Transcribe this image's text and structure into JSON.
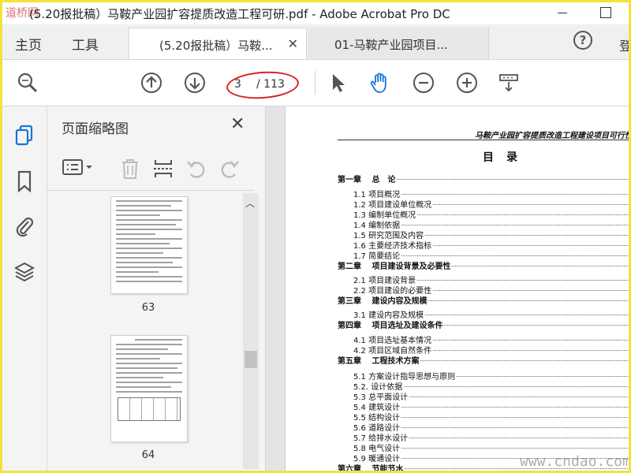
{
  "window": {
    "title": "(5.20报批稿）马鞍产业园扩容提质改造工程可研.pdf - Adobe Acrobat Pro DC",
    "logo_text": "道桥网"
  },
  "tabs": {
    "home": "主页",
    "tools": "工具",
    "doc_active": "(5.20报批稿）马鞍...",
    "doc_inactive": "01-马鞍产业园项目...",
    "login": "登"
  },
  "toolbar": {
    "page_current": "3",
    "page_total": "/ 113",
    "icons": [
      "zoom-icon",
      "page-up-icon",
      "page-down-icon",
      "select-arrow-icon",
      "hand-icon",
      "zoom-out-icon",
      "zoom-in-icon",
      "scroll-mode-icon"
    ]
  },
  "panel": {
    "title": "页面缩略图",
    "thumbs": [
      {
        "label": "63"
      },
      {
        "label": "64"
      }
    ]
  },
  "doc": {
    "header": "马鞍产业园扩容提质改造工程建设项目可行性",
    "title": "目录",
    "toc": [
      {
        "text": "第一章　 总　论",
        "chapter": true
      },
      {
        "text": "1.1 项目概况",
        "chapter": false
      },
      {
        "text": "1.2 项目建设单位概况",
        "chapter": false
      },
      {
        "text": "1.3 编制单位概况",
        "chapter": false
      },
      {
        "text": "1.4 编制依据",
        "chapter": false
      },
      {
        "text": "1.5 研究范围及内容",
        "chapter": false
      },
      {
        "text": "1.6 主要经济技术指标",
        "chapter": false
      },
      {
        "text": "1.7 简要结论",
        "chapter": false
      },
      {
        "text": "第二章　 项目建设背景及必要性",
        "chapter": true
      },
      {
        "text": "2.1 项目建设背景",
        "chapter": false
      },
      {
        "text": "2.2 项目建设的必要性",
        "chapter": false
      },
      {
        "text": "第三章　 建设内容及规模",
        "chapter": true
      },
      {
        "text": "3.1 建设内容及规模",
        "chapter": false
      },
      {
        "text": "第四章　 项目选址及建设条件",
        "chapter": true
      },
      {
        "text": "4.1 项目选址基本情况",
        "chapter": false
      },
      {
        "text": "4.2 项目区域自然条件",
        "chapter": false
      },
      {
        "text": "第五章　 工程技术方案",
        "chapter": true
      },
      {
        "text": "5.1 方案设计指导思想与原则",
        "chapter": false
      },
      {
        "text": "5.2. 设计依据",
        "chapter": false
      },
      {
        "text": "5.3 总平面设计",
        "chapter": false
      },
      {
        "text": "5.4 建筑设计",
        "chapter": false
      },
      {
        "text": "5.5 结构设计",
        "chapter": false
      },
      {
        "text": "5.6 道路设计",
        "chapter": false
      },
      {
        "text": "5.7 给排水设计",
        "chapter": false
      },
      {
        "text": "5.8 电气设计",
        "chapter": false
      },
      {
        "text": "5.9 暖通设计",
        "chapter": false
      },
      {
        "text": "第六章　 节能节水",
        "chapter": true
      }
    ]
  },
  "watermark": "www.cndao.com"
}
